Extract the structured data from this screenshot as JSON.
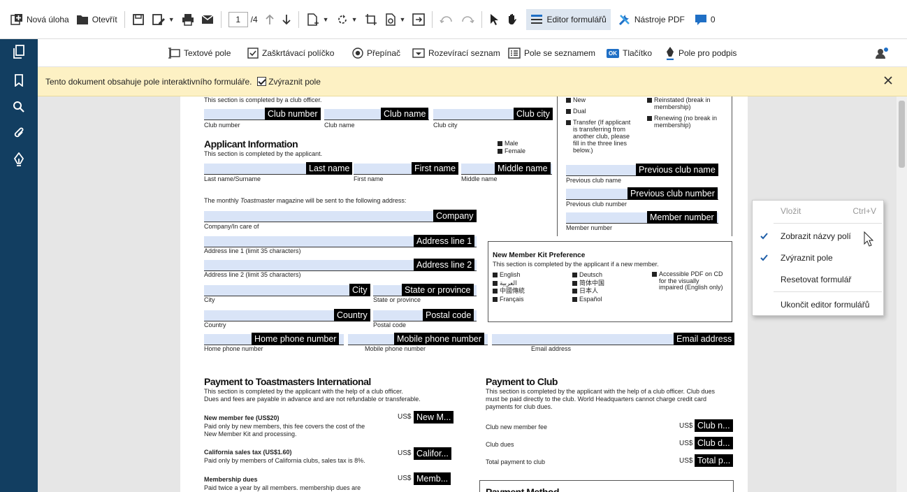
{
  "toolbar": {
    "new_task": "Nová úloha",
    "open": "Otevřít",
    "page_current": "1",
    "page_total": "/4",
    "form_editor": "Editor formulářů",
    "pdf_tools": "Nástroje PDF",
    "comments_count": "0"
  },
  "form_tools": {
    "text_field": "Textové pole",
    "checkbox": "Zaškrtávací políčko",
    "radio": "Přepínač",
    "dropdown": "Rozevírací seznam",
    "listbox": "Pole se seznamem",
    "button_badge": "OK",
    "button": "Tlačítko",
    "signature": "Pole pro podpis"
  },
  "banner": {
    "message": "Tento dokument obsahuje pole interaktivního formuláře.",
    "highlight": "Zvýraznit pole"
  },
  "document": {
    "club_note": "This section is completed by a club officer.",
    "club_fields": [
      "Club number",
      "Club name",
      "Club city"
    ],
    "membership_types": [
      "New",
      "Dual",
      "Transfer (If applicant",
      "is transferring from",
      "another club, please",
      "fill in the three lines",
      "below.)"
    ],
    "membership_types_2": [
      "Reinstated (break in",
      "membership)",
      "Renewing (no break in",
      "membership)"
    ],
    "applicant_title": "Applicant Information",
    "applicant_note": "This section is completed by the applicant.",
    "gender": [
      "Male",
      "Female"
    ],
    "name_fields": [
      "Last name",
      "First name",
      "Middle name"
    ],
    "name_labels": [
      "Last name/Surname",
      "First name",
      "Middle name"
    ],
    "prev_fields": [
      "Previous club name",
      "Previous club number",
      "Member number"
    ],
    "prev_labels": [
      "Previous club name",
      "Previous club number",
      "Member number"
    ],
    "magazine_note_1": "The monthly ",
    "magazine_note_em": "Toastmaster",
    "magazine_note_2": " magazine will be sent to the following address:",
    "company": "Company",
    "company_label": "Company/In care of",
    "addr1": "Address line 1",
    "addr1_label": "Address line 1 (limit 35 characters)",
    "addr2": "Address line 2",
    "addr2_label": "Address line 2 (limit 35 characters)",
    "city": "City",
    "city_label": "City",
    "state": "State or province",
    "state_label": "State or province",
    "country": "Country",
    "country_label": "Country",
    "postal": "Postal code",
    "postal_label": "Postal code",
    "phones": [
      "Home phone number",
      "Mobile phone number",
      "Email address"
    ],
    "phone_labels": [
      "Home phone number",
      "Mobile phone number",
      "Email address"
    ],
    "kit_title": "New Member Kit Preference",
    "kit_note": "This section is completed by the applicant if a new member.",
    "kit_col1": [
      "English",
      "العربية",
      "中國傳統",
      "Français"
    ],
    "kit_col2": [
      "Deutsch",
      "简体中国",
      "日本人",
      "Español"
    ],
    "kit_col3": [
      "Accessible PDF on CD",
      "for the visually",
      "impaired (English only)"
    ],
    "pay_ti_title": "Payment to Toastmasters International",
    "pay_ti_note1": "This section is completed by the applicant with the help of a club officer.",
    "pay_ti_note2": "Dues and fees are payable in advance and are not refundable or transferable.",
    "fee1_title": "New member fee (US$20)",
    "fee1_desc1": "Paid only by new members, this fee covers the cost of the",
    "fee1_desc2": "New Member Kit and processing.",
    "fee2_title": "California sales tax (US$1.60)",
    "fee2_desc": "Paid only by members of California clubs, sales tax is 8%.",
    "fee3_title": "Membership dues",
    "fee3_desc": "Paid twice a year by all members. membership dues are",
    "currency": "US$",
    "fee_fields": [
      "New M...",
      "Califor...",
      "Memb..."
    ],
    "pay_club_title": "Payment to Club",
    "pay_club_note1": "This section is completed by the applicant with the help of a club officer. Club dues",
    "pay_club_note2": "must be paid directly to the club. World Headquarters cannot charge credit card",
    "pay_club_note3": "payments for club dues.",
    "club_rows": [
      "Club new member fee",
      "Club dues",
      "Total payment to club"
    ],
    "club_fee_fields": [
      "Club n...",
      "Club d...",
      "Total p..."
    ],
    "payment_method_partial": "Payment Method"
  },
  "context_menu": {
    "paste": "Vložit",
    "paste_key": "Ctrl+V",
    "show_names": "Zobrazit názvy polí",
    "highlight": "Zvýraznit pole",
    "reset": "Resetovat formulář",
    "exit": "Ukončit editor formulářů"
  },
  "colors": {
    "sidebar": "#123e61",
    "banner": "#fdf1c4",
    "field": "#d9e4f7",
    "accent": "#1f6fc5"
  }
}
